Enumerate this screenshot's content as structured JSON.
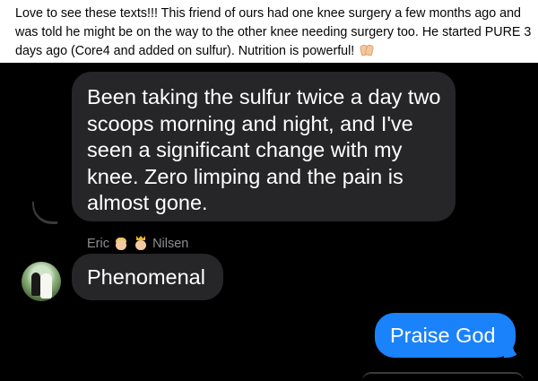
{
  "post": {
    "caption": "Love to see these texts!!! This friend of ours had one knee surgery a few months ago and was told he might be on the way to the other knee needing surgery too. He started PURE 3 days ago (Core4 and added on sulfur). Nutrition is powerful!",
    "caption_icon": "raised-hands-emoji"
  },
  "messages": {
    "received_1": "Been taking the sulfur twice a day two scoops morning and night, and I've seen a significant change with my knee. Zero limping and the pain is almost gone.",
    "sender_first": "Eric",
    "sender_last": "Nilsen",
    "sender_emojis": [
      "blond-person-emoji",
      "crown-emoji"
    ],
    "received_2": "Phenomenal",
    "sent_1": "Praise God"
  },
  "colors": {
    "background": "#000000",
    "received_bubble": "#262629",
    "sent_bubble": "#1a82fb",
    "sender_label": "#8e8e93"
  }
}
